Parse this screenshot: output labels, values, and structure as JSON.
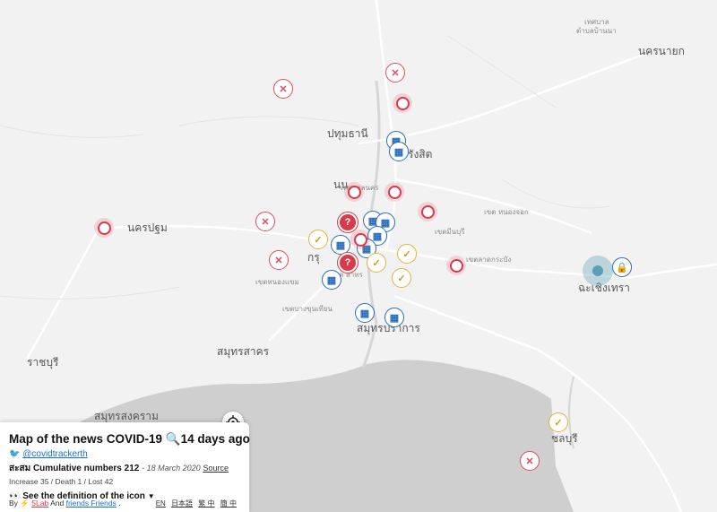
{
  "map": {
    "labels": [
      {
        "key": "nakhon_nayok",
        "text": "นครนายก",
        "cls": "city"
      },
      {
        "key": "pathum",
        "text": "ปทุมธานี",
        "cls": "city"
      },
      {
        "key": "nakhon_pathom",
        "text": "นครปฐม",
        "cls": "city"
      },
      {
        "key": "krung",
        "text": "กรุ",
        "cls": "city"
      },
      {
        "key": "samut_sakhon",
        "text": "สมุทรสาคร",
        "cls": "city"
      },
      {
        "key": "samut_prakan",
        "text": "สมุทรปราการ",
        "cls": "city"
      },
      {
        "key": "chachoengsao",
        "text": "ฉะเชิงเทรา",
        "cls": "city"
      },
      {
        "key": "ratchaburi",
        "text": "ราชบุรี",
        "cls": "city"
      },
      {
        "key": "samut_songkhram",
        "text": "สมุทรสงคราม",
        "cls": "city"
      },
      {
        "key": "chonburi",
        "text": "ชลบุรี",
        "cls": "city"
      },
      {
        "key": "na",
        "text": "นน",
        "cls": "city"
      },
      {
        "key": "rangsit",
        "text": "รังสิต",
        "cls": "city"
      },
      {
        "key": "thetsaban_top",
        "text": "เทศบาล",
        "cls": "small"
      },
      {
        "key": "thetsaban_top2",
        "text": "ตำบลบ้านนา",
        "cls": "small"
      },
      {
        "key": "thetsaban_nakhon",
        "text": "เทศบาลนคร",
        "cls": "small"
      },
      {
        "key": "khet_nongchok",
        "text": "เขต หนองจอก",
        "cls": "small"
      },
      {
        "key": "khet_minburi",
        "text": "เขตมีนบุรี",
        "cls": "small"
      },
      {
        "key": "khet_lat",
        "text": "เขตลาดกระบัง",
        "cls": "small"
      },
      {
        "key": "khet_nongkhaem",
        "text": "เขตหนองแขม",
        "cls": "small"
      },
      {
        "key": "khet_bangkhun",
        "text": "เขตบางขุนเทียน",
        "cls": "small"
      },
      {
        "key": "khet_sathon",
        "text": "เขต สาทร",
        "cls": "small"
      }
    ],
    "markers": [
      {
        "type": "x",
        "icon": "close-icon",
        "glyph": "✕"
      },
      {
        "type": "x",
        "icon": "close-icon",
        "glyph": "✕"
      },
      {
        "type": "ring",
        "icon": "ring-icon",
        "glyph": ""
      },
      {
        "type": "ring",
        "icon": "ring-icon",
        "glyph": ""
      },
      {
        "type": "hosp",
        "icon": "hospital-icon",
        "glyph": "▦"
      },
      {
        "type": "hosp",
        "icon": "hospital-icon",
        "glyph": "▦"
      },
      {
        "type": "ring",
        "icon": "ring-icon",
        "glyph": ""
      },
      {
        "type": "ring",
        "icon": "ring-icon",
        "glyph": ""
      },
      {
        "type": "ring",
        "icon": "ring-icon",
        "glyph": ""
      },
      {
        "type": "hosp",
        "icon": "hospital-icon",
        "glyph": "▦"
      },
      {
        "type": "hosp",
        "icon": "hospital-icon",
        "glyph": "▦"
      },
      {
        "type": "q",
        "icon": "question-icon",
        "glyph": "?"
      },
      {
        "type": "hosp",
        "icon": "hospital-icon",
        "glyph": "▦"
      },
      {
        "type": "hosp",
        "icon": "hospital-icon",
        "glyph": "▦"
      },
      {
        "type": "shield",
        "icon": "shield-icon",
        "glyph": "✓"
      },
      {
        "type": "hosp",
        "icon": "hospital-icon",
        "glyph": "▦"
      },
      {
        "type": "ring",
        "icon": "ring-icon",
        "glyph": ""
      },
      {
        "type": "q",
        "icon": "question-icon",
        "glyph": "?"
      },
      {
        "type": "shield",
        "icon": "shield-icon",
        "glyph": "✓"
      },
      {
        "type": "shield",
        "icon": "shield-icon",
        "glyph": "✓"
      },
      {
        "type": "shield",
        "icon": "shield-icon",
        "glyph": "✓"
      },
      {
        "type": "x",
        "icon": "close-icon",
        "glyph": "✕"
      },
      {
        "type": "hosp",
        "icon": "hospital-icon",
        "glyph": "▦"
      },
      {
        "type": "ring",
        "icon": "ring-icon",
        "glyph": ""
      },
      {
        "type": "hosp",
        "icon": "hospital-icon",
        "glyph": "▦"
      },
      {
        "type": "hosp",
        "icon": "hospital-icon",
        "glyph": "▦"
      },
      {
        "type": "x",
        "icon": "close-icon",
        "glyph": "✕"
      },
      {
        "type": "teal",
        "icon": "cluster-icon",
        "glyph": ""
      },
      {
        "type": "hosp",
        "icon": "lock-icon",
        "glyph": "🔒"
      },
      {
        "type": "shield",
        "icon": "shield-icon",
        "glyph": "✓"
      },
      {
        "type": "x",
        "icon": "close-icon",
        "glyph": "✕"
      }
    ]
  },
  "panel": {
    "title": "Map of the news COVID-19 🔍14 days ago",
    "twitter": "@covidtrackerth",
    "cumulative_label": "สะสม Cumulative numbers 212",
    "date": "- 18 March 2020",
    "source": "Source",
    "stats": "Increase 35 / Death 1 / Lost 42",
    "definition": "👀 See the definition of the icon",
    "by": "By",
    "lab": "5Lab",
    "and": "And",
    "friends": "friends Friends",
    "dot": ".",
    "langs": [
      "EN",
      "日本語",
      "繁 中",
      "簡 中"
    ]
  },
  "colors": {
    "red": "#d93a4a",
    "blue": "#2b6cb8",
    "gold": "#e5b13a",
    "teal": "#5a9fb3",
    "water": "#cfcfcf",
    "land": "#f2f2f2"
  }
}
